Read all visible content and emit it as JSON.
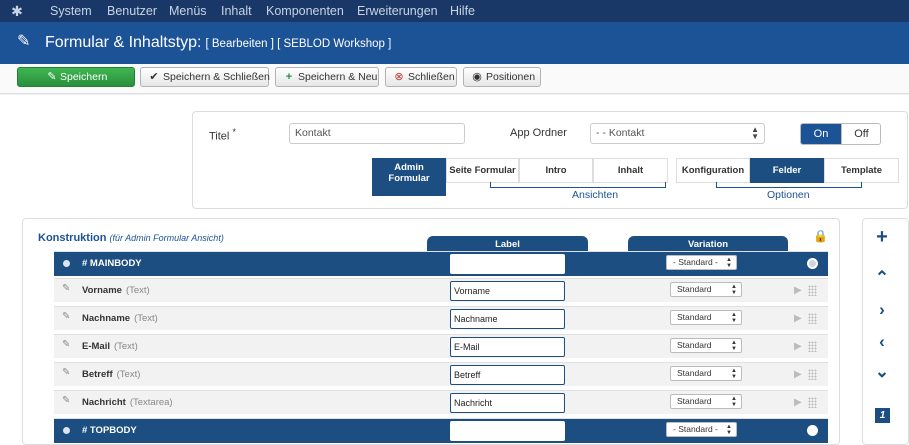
{
  "menubar": {
    "logo_icon": "joomla-logo-icon",
    "items": [
      "System",
      "Benutzer",
      "Menüs",
      "Inhalt",
      "Komponenten",
      "Erweiterungen",
      "Hilfe"
    ]
  },
  "header": {
    "icon": "pencil-icon",
    "title": "Formular & Inhaltstyp:",
    "subtitle": "[ Bearbeiten ] [ SEBLOD Workshop ]"
  },
  "toolbar": {
    "save": "Speichern",
    "save_close": "Speichern & Schließen",
    "save_new": "Speichern & Neu",
    "close": "Schließen",
    "positions": "Positionen"
  },
  "form": {
    "title_label": "Titel",
    "title_required": "*",
    "title_value": "Kontakt",
    "app_folder_label": "App Ordner",
    "app_folder_value": "- - Kontakt",
    "toggle_on": "On",
    "toggle_off": "Off"
  },
  "views_tabs": {
    "admin_line1": "Admin",
    "admin_line2": "Formular",
    "site": "Seite Formular",
    "intro": "Intro",
    "content": "Inhalt",
    "group_label": "Ansichten"
  },
  "option_tabs": {
    "config": "Konfiguration",
    "fields": "Felder",
    "template": "Template",
    "group_label": "Optionen"
  },
  "construction": {
    "title": "Konstruktion",
    "subtitle": "(für Admin Formular Ansicht)",
    "col_label": "Label",
    "col_variation": "Variation",
    "rows": [
      {
        "name": "# MAINBODY",
        "type": "",
        "label": "",
        "variation": "- Standard -",
        "kind": "position"
      },
      {
        "name": "Vorname",
        "type": "(Text)",
        "label": "Vorname",
        "variation": "Standard",
        "kind": "field"
      },
      {
        "name": "Nachname",
        "type": "(Text)",
        "label": "Nachname",
        "variation": "Standard",
        "kind": "field"
      },
      {
        "name": "E-Mail",
        "type": "(Text)",
        "label": "E-Mail",
        "variation": "Standard",
        "kind": "field"
      },
      {
        "name": "Betreff",
        "type": "(Text)",
        "label": "Betreff",
        "variation": "Standard",
        "kind": "field"
      },
      {
        "name": "Nachricht",
        "type": "(Textarea)",
        "label": "Nachricht",
        "variation": "Standard",
        "kind": "field"
      },
      {
        "name": "# TOPBODY",
        "type": "",
        "label": "",
        "variation": "- Standard -",
        "kind": "position"
      }
    ]
  },
  "side": {
    "add": "+",
    "page_number": "1"
  },
  "colors": {
    "menubar": "#1a3867",
    "header": "#1c5296",
    "accent": "#1c4e82",
    "save_green": "#2f9e44"
  }
}
